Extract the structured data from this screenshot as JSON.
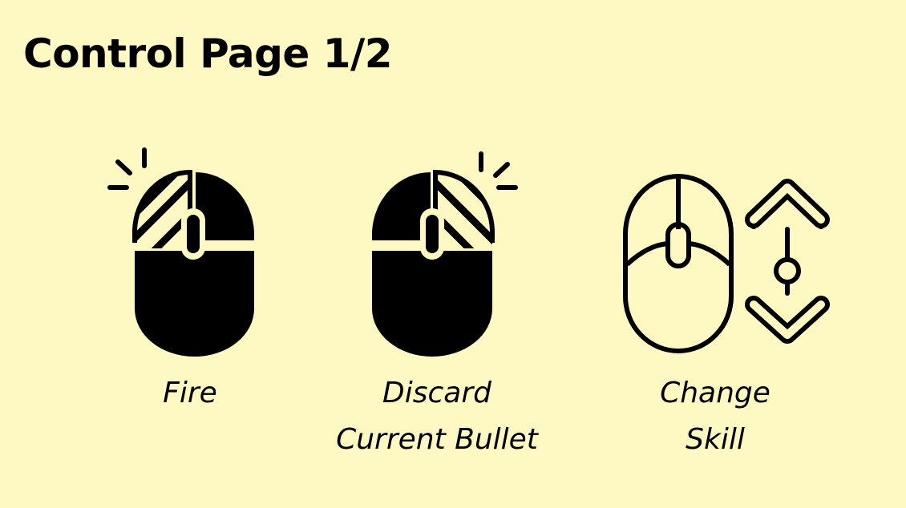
{
  "page": {
    "title": "Control Page 1/2",
    "background_color": "#fef9c2"
  },
  "controls": [
    {
      "icon": "mouse-left-click-icon",
      "lines": [
        "Fire"
      ]
    },
    {
      "icon": "mouse-right-click-icon",
      "lines": [
        "Discard",
        "Current Bullet"
      ]
    },
    {
      "icon": "mouse-scroll-wheel-icon",
      "lines": [
        "Change",
        "Skill"
      ]
    }
  ]
}
